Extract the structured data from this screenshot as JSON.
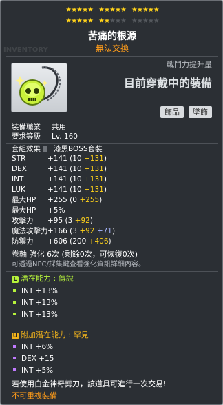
{
  "background_text": "INVENTORY",
  "item": {
    "name": "苦痛的根源",
    "trade_status": "無法交換"
  },
  "stars": {
    "filled": 22,
    "total": 25
  },
  "compare": {
    "power_label": "戰鬥力提升量",
    "equipped_text": "目前穿戴中的裝備",
    "badges": [
      "飾品",
      "墜飾"
    ]
  },
  "requirements": [
    {
      "label": "裝備職業",
      "value": "共用"
    },
    {
      "label": "要求等級",
      "value": "Lv. 160"
    }
  ],
  "set_effect": {
    "label": "套組效果",
    "value": "漆黑BOSS套裝"
  },
  "stats": [
    {
      "name": "STR",
      "total": "+141",
      "base": "10",
      "bonus": "+131"
    },
    {
      "name": "DEX",
      "total": "+141",
      "base": "10",
      "bonus": "+131"
    },
    {
      "name": "INT",
      "total": "+141",
      "base": "10",
      "bonus": "+131"
    },
    {
      "name": "LUK",
      "total": "+141",
      "base": "10",
      "bonus": "+131"
    },
    {
      "name": "最大HP",
      "total": "+255",
      "base": "0",
      "bonus": "+255"
    },
    {
      "name": "最大HP",
      "total": "+5%"
    },
    {
      "name": "攻擊力",
      "total": "+95",
      "base": "3",
      "bonus": "+92"
    },
    {
      "name": "魔法攻擊力",
      "total": "+166",
      "base": "3",
      "bonus": "+92",
      "extra": "+71"
    },
    {
      "name": "防禦力",
      "total": "+606",
      "base": "200",
      "bonus": "+406"
    }
  ],
  "upgrade": {
    "text": "卷軸 強化 6次 (剩餘0次，可恢復0次)",
    "hint": "可透過NPC/採集鍵查看強化資訊詳細內容。"
  },
  "potential": {
    "tier_letter": "L",
    "title": "潛在能力 : 傳說",
    "lines": [
      "INT +13%",
      "INT +13%",
      "INT +13%"
    ]
  },
  "additional_potential": {
    "tier_letter": "U",
    "title": "附加潛在能力 : 罕見",
    "lines": [
      "INT +6%",
      "DEX +15",
      "INT +5%"
    ]
  },
  "footer": {
    "scissors_note": "若使用白金神奇剪刀，該道具可進行一次交易!",
    "untradable_note": "不可重複裝備"
  },
  "colors": {
    "star_filled": "#ffd21a",
    "star_empty": "#55595e",
    "trade_status": "#ff9c1a",
    "bonus": "#ffd21a",
    "legendary": "#b6f23b",
    "unique": "#f0b21b",
    "extra_stat": "#a9b8ff"
  }
}
